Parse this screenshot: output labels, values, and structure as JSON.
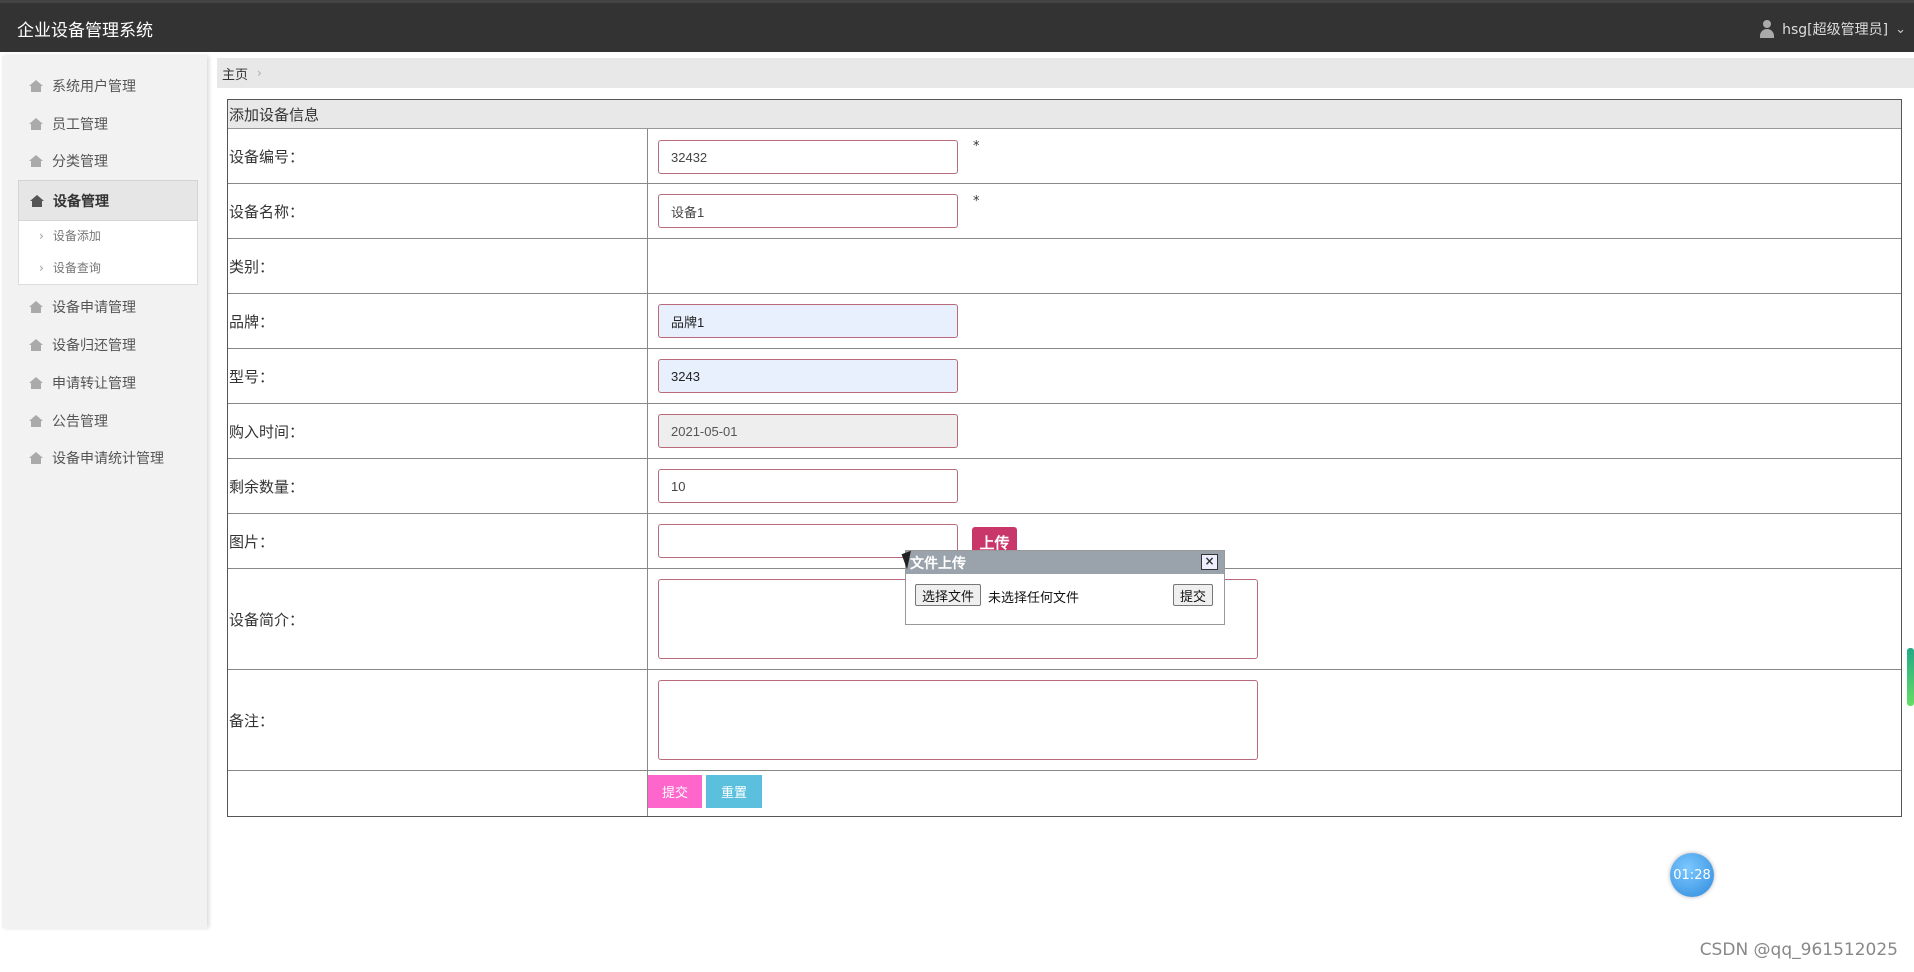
{
  "header": {
    "app_title": "企业设备管理系统",
    "user_label": "hsg[超级管理员]"
  },
  "sidebar": {
    "items": [
      {
        "label": "系统用户管理"
      },
      {
        "label": "员工管理"
      },
      {
        "label": "分类管理"
      },
      {
        "label": "设备管理",
        "active": true
      },
      {
        "label": "设备申请管理"
      },
      {
        "label": "设备归还管理"
      },
      {
        "label": "申请转让管理"
      },
      {
        "label": "公告管理"
      },
      {
        "label": "设备申请统计管理"
      }
    ],
    "sub_items": [
      {
        "label": "设备添加"
      },
      {
        "label": "设备查询"
      }
    ]
  },
  "breadcrumb": {
    "home": "主页"
  },
  "form": {
    "title": "添加设备信息",
    "required_mark": "*",
    "fields": {
      "device_no": {
        "label": "设备编号：",
        "value": "32432"
      },
      "device_name": {
        "label": "设备名称：",
        "value": "设备1"
      },
      "category": {
        "label": "类别："
      },
      "brand": {
        "label": "品牌：",
        "value": "品牌1"
      },
      "model": {
        "label": "型号：",
        "value": "3243"
      },
      "purchase_date": {
        "label": "购入时间：",
        "value": "2021-05-01"
      },
      "remaining": {
        "label": "剩余数量：",
        "value": "10"
      },
      "image": {
        "label": "图片：",
        "value": ""
      },
      "description": {
        "label": "设备简介："
      },
      "remark": {
        "label": "备注："
      }
    },
    "upload_button": "上传",
    "submit_button": "提交",
    "reset_button": "重置"
  },
  "upload_popup": {
    "title": "文件上传",
    "close": "×",
    "choose_file": "选择文件",
    "no_file": "未选择任何文件",
    "submit": "提交"
  },
  "timer": "01:28",
  "watermark": "CSDN @qq_961512025"
}
